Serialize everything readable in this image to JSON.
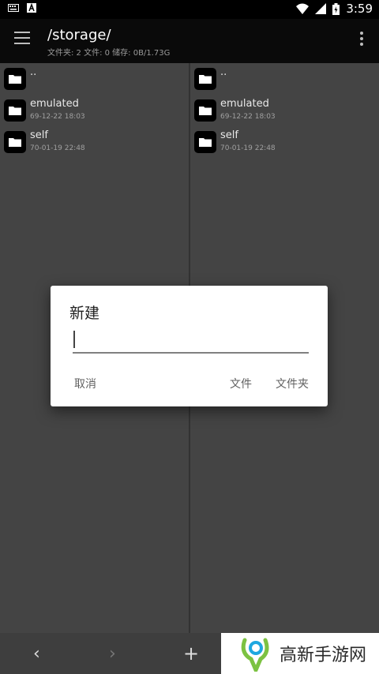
{
  "status_bar": {
    "time": "3:59",
    "icons": [
      "keyboard-icon",
      "a-badge-icon",
      "wifi-icon",
      "signal-icon",
      "battery-icon"
    ]
  },
  "app_bar": {
    "title": "/storage/",
    "subtitle": "文件夹: 2  文件: 0  储存: 0B/1.73G"
  },
  "left_pane": {
    "items": [
      {
        "name": "..",
        "date": ""
      },
      {
        "name": "emulated",
        "date": "69-12-22 18:03"
      },
      {
        "name": "self",
        "date": "70-01-19 22:48"
      }
    ]
  },
  "right_pane": {
    "items": [
      {
        "name": "..",
        "date": ""
      },
      {
        "name": "emulated",
        "date": "69-12-22 18:03"
      },
      {
        "name": "self",
        "date": "70-01-19 22:48"
      }
    ]
  },
  "bottom_bar": {
    "back": "‹",
    "forward": "›",
    "add": "+"
  },
  "dialog": {
    "title": "新建",
    "input_value": "",
    "cancel": "取消",
    "file": "文件",
    "folder": "文件夹"
  },
  "watermark": {
    "text": "高新手游网"
  },
  "colors": {
    "pane_bg": "#444444",
    "appbar_bg": "#0a0a0a",
    "dialog_bg": "#ffffff",
    "accent_green": "#7cc242"
  }
}
